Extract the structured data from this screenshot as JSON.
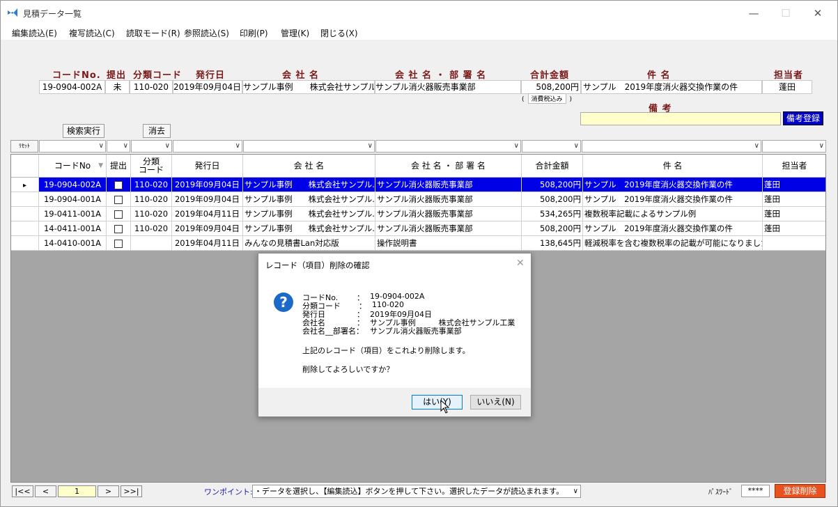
{
  "window": {
    "title": "見積データ一覧",
    "minimize": "—",
    "maximize": "☐",
    "close": "✕"
  },
  "menu": [
    "編集読込(E)",
    "複写読込(C)",
    "読取モード(R)",
    "参照読込(S)",
    "印刷(P)",
    "管理(K)",
    "閉じる(X)"
  ],
  "record_header": {
    "labels": {
      "code": "コードNo.",
      "submit": "提出",
      "category": "分類コード",
      "date": "発行日",
      "company": "会 社 名",
      "dept": "会 社 名 ・ 部 署 名",
      "total": "合計金額",
      "subject": "件 名",
      "person": "担当者",
      "remarks": "備 考"
    },
    "values": {
      "code": "19-0904-002A",
      "submit": "未",
      "category": "110-020",
      "date": "2019年09月04日",
      "company": "サンプル事例　　株式会社サンプル",
      "dept": "サンプル消火器販売事業部",
      "total": "508,200円",
      "subject": "サンプル　2019年度消火器交換作業の件",
      "person": "蓬田"
    },
    "tax_note": "消費税込み",
    "remarks_button": "備考登録"
  },
  "buttons": {
    "search": "検索実行",
    "clear": "消去",
    "reset": "ﾘｾｯﾄ"
  },
  "grid": {
    "columns": [
      "コードNo",
      "提出",
      "分類\nコード",
      "発行日",
      "会 社 名",
      "会 社 名 ・ 部 署 名",
      "合計金額",
      "件 名",
      "担当者"
    ],
    "rows": [
      {
        "code": "19-0904-002A",
        "category": "110-020",
        "date": "2019年09月04日",
        "company": "サンプル事例　　株式会社サンプル...",
        "dept": "サンプル消火器販売事業部",
        "total": "508,200円",
        "subject": "サンプル　2019年度消火器交換作業の件",
        "person": "蓬田",
        "selected": true
      },
      {
        "code": "19-0904-001A",
        "category": "110-020",
        "date": "2019年09月04日",
        "company": "サンプル事例　　株式会社サンプル...",
        "dept": "サンプル消火器販売事業部",
        "total": "508,200円",
        "subject": "サンプル　2019年度消火器交換作業の件",
        "person": "蓬田",
        "selected": false
      },
      {
        "code": "19-0411-001A",
        "category": "110-020",
        "date": "2019年04月11日",
        "company": "サンプル事例　　株式会社サンプル...",
        "dept": "サンプル消火器販売事業部",
        "total": "534,265円",
        "subject": "複数税率記載によるサンプル例",
        "person": "蓬田",
        "selected": false
      },
      {
        "code": "14-0411-001A",
        "category": "110-020",
        "date": "2019年09月04日",
        "company": "サンプル事例　　株式会社サンプル...",
        "dept": "サンプル消火器販売事業部",
        "total": "508,200円",
        "subject": "サンプル　2019年度消火器交換作業の件",
        "person": "蓬田",
        "selected": false
      },
      {
        "code": "14-0410-001A",
        "category": "",
        "date": "2019年04月11日",
        "company": "みんなの見積書Lan対応版",
        "dept": "操作説明書",
        "total": "138,645円",
        "subject": "軽減税率を含む複数税率の記載が可能になりました",
        "person": "",
        "selected": false
      }
    ]
  },
  "dialog": {
    "title": "レコード（項目）削除の確認",
    "fields": [
      {
        "label": "コードNo.",
        "sep": "：",
        "value": "19-0904-002A"
      },
      {
        "label": "分類コード",
        "sep": "：",
        "value": "110-020"
      },
      {
        "label": "発行日",
        "sep": "：",
        "value": "2019年09月04日"
      },
      {
        "label": "会社名",
        "sep": "：",
        "value": "サンプル事例　　　株式会社サンプル工業"
      },
      {
        "label": "会社名__部署名：",
        "sep": "",
        "value": "サンプル消火器販売事業部"
      }
    ],
    "message1": "上記のレコード（項目）をこれより削除します。",
    "message2": "削除してよろしいですか？",
    "yes": "はい(Y)",
    "no": "いいえ(N)"
  },
  "status": {
    "nav": {
      "first": "|<<",
      "prev": "<",
      "page": "1",
      "next": ">",
      "last": ">>|"
    },
    "hint_label": "ワンポイント:",
    "hint": "・データを選択し、【編集読込】ボタンを押して下さい。選択したデータが読込まれます。",
    "password_label": "ﾊﾟｽﾜｰﾄﾞ",
    "password": "****",
    "delete": "登録削除"
  },
  "colors": {
    "accent": "#0000e6",
    "header_text": "#7a1818",
    "delete_button": "#e8521e",
    "remarks_field": "#ffffcc"
  }
}
